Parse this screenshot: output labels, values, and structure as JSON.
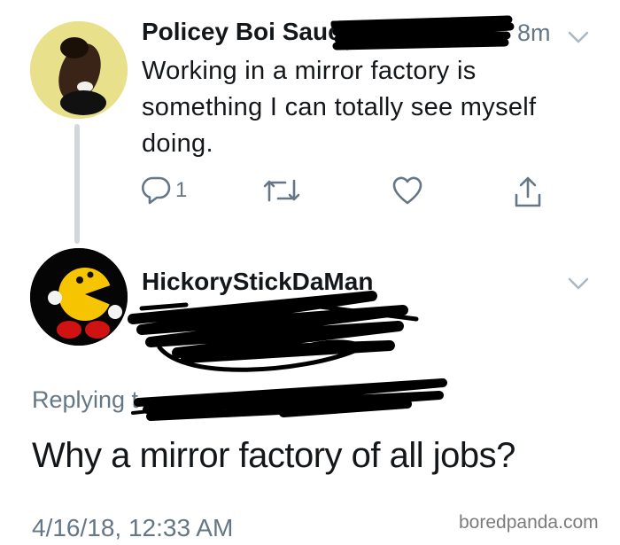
{
  "tweet1": {
    "author": "Policey Boi Sauce",
    "time": "8m",
    "text": "Working in a mirror factory is something I can totally see myself doing.",
    "reply_count": "1"
  },
  "tweet2": {
    "author": "HickoryStickDaMan",
    "replying_prefix": "Replying t",
    "text": "Why a mirror factory of all jobs?",
    "timestamp": "4/16/18, 12:33 AM"
  },
  "watermark": "boredpanda.com",
  "icons": {
    "reply": "reply-icon",
    "retweet": "retweet-icon",
    "like": "like-icon",
    "share": "share-icon",
    "chevron": "chevron-down-icon"
  },
  "colors": {
    "text": "#14171a",
    "secondary": "#657786",
    "thread_line": "#d2d7db",
    "redaction": "#000000"
  }
}
